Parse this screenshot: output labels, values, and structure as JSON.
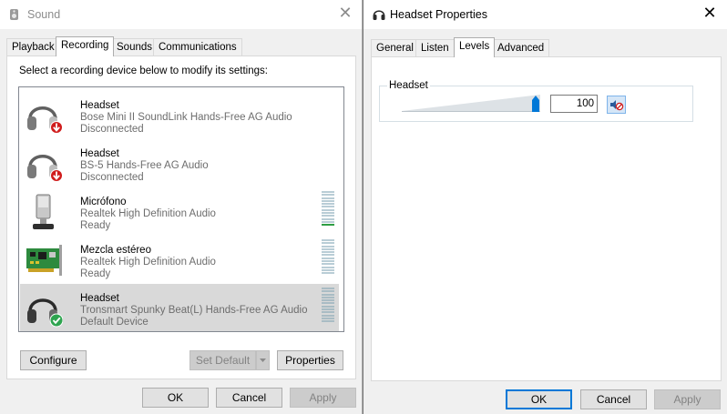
{
  "sound": {
    "title": "Sound",
    "tabs": [
      "Playback",
      "Recording",
      "Sounds",
      "Communications"
    ],
    "active_tab": "Recording",
    "instruction": "Select a recording device below to modify its settings:",
    "devices": [
      {
        "name": "Headset",
        "desc": "Bose Mini II SoundLink Hands-Free AG Audio",
        "status": "Disconnected",
        "icon": "headset-disconnected-icon",
        "meter": false
      },
      {
        "name": "Headset",
        "desc": "BS-5 Hands-Free AG Audio",
        "status": "Disconnected",
        "icon": "headset-disconnected-icon",
        "meter": false
      },
      {
        "name": "Micrófono",
        "desc": "Realtek High Definition Audio",
        "status": "Ready",
        "icon": "microphone-icon",
        "meter": true
      },
      {
        "name": "Mezcla estéreo",
        "desc": "Realtek High Definition Audio",
        "status": "Ready",
        "icon": "sound-card-icon",
        "meter": true
      },
      {
        "name": "Headset",
        "desc": "Tronsmart Spunky Beat(L) Hands-Free AG Audio",
        "status": "Default Device",
        "icon": "headset-default-icon",
        "meter": true,
        "selected": true
      }
    ],
    "buttons": {
      "configure": "Configure",
      "set_default": "Set Default",
      "properties": "Properties",
      "ok": "OK",
      "cancel": "Cancel",
      "apply": "Apply"
    }
  },
  "props": {
    "title": "Headset Properties",
    "tabs": [
      "General",
      "Listen",
      "Levels",
      "Advanced"
    ],
    "active_tab": "Levels",
    "level_label": "Headset",
    "level_value": "100",
    "level_fraction": 1.0,
    "buttons": {
      "ok": "OK",
      "cancel": "Cancel",
      "apply": "Apply"
    }
  },
  "colors": {
    "accent": "#0078d7",
    "selection": "#d9d9d9",
    "meter_active": "#2f9e44",
    "disconnect": "#d83b01",
    "default_check": "#2ea44f"
  }
}
